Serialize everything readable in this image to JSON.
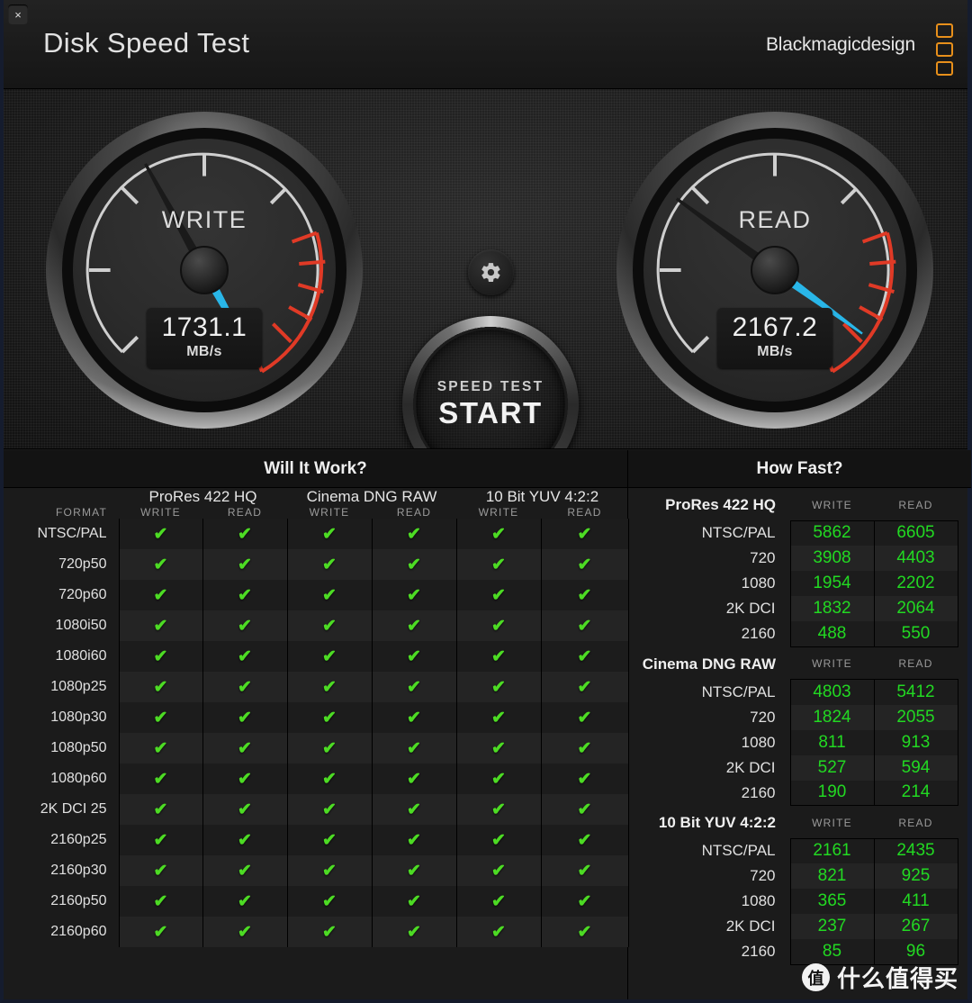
{
  "window": {
    "close_label": "×"
  },
  "header": {
    "title": "Disk Speed Test",
    "brand": "Blackmagicdesign"
  },
  "gauges": {
    "write": {
      "label": "WRITE",
      "value": "1731.1",
      "unit": "MB/s",
      "needle_angle_deg": -119
    },
    "read": {
      "label": "READ",
      "value": "2167.2",
      "unit": "MB/s",
      "needle_angle_deg": -144
    },
    "colors": {
      "needle": "#29b6e8",
      "redzone": "#e03a26",
      "scale": "#cfcfcf"
    }
  },
  "controls": {
    "gear_icon": "gear-icon",
    "start_sub": "SPEED TEST",
    "start_main": "START"
  },
  "will_it_work": {
    "title": "Will It Work?",
    "format_header": "FORMAT",
    "groups": [
      "ProRes 422 HQ",
      "Cinema DNG RAW",
      "10 Bit YUV 4:2:2"
    ],
    "sub_headers": [
      "WRITE",
      "READ"
    ],
    "check_glyph": "✔",
    "check_color": "#4ddb24",
    "rows": [
      {
        "format": "NTSC/PAL",
        "cells": [
          true,
          true,
          true,
          true,
          true,
          true
        ]
      },
      {
        "format": "720p50",
        "cells": [
          true,
          true,
          true,
          true,
          true,
          true
        ]
      },
      {
        "format": "720p60",
        "cells": [
          true,
          true,
          true,
          true,
          true,
          true
        ]
      },
      {
        "format": "1080i50",
        "cells": [
          true,
          true,
          true,
          true,
          true,
          true
        ]
      },
      {
        "format": "1080i60",
        "cells": [
          true,
          true,
          true,
          true,
          true,
          true
        ]
      },
      {
        "format": "1080p25",
        "cells": [
          true,
          true,
          true,
          true,
          true,
          true
        ]
      },
      {
        "format": "1080p30",
        "cells": [
          true,
          true,
          true,
          true,
          true,
          true
        ]
      },
      {
        "format": "1080p50",
        "cells": [
          true,
          true,
          true,
          true,
          true,
          true
        ]
      },
      {
        "format": "1080p60",
        "cells": [
          true,
          true,
          true,
          true,
          true,
          true
        ]
      },
      {
        "format": "2K DCI 25",
        "cells": [
          true,
          true,
          true,
          true,
          true,
          true
        ]
      },
      {
        "format": "2160p25",
        "cells": [
          true,
          true,
          true,
          true,
          true,
          true
        ]
      },
      {
        "format": "2160p30",
        "cells": [
          true,
          true,
          true,
          true,
          true,
          true
        ]
      },
      {
        "format": "2160p50",
        "cells": [
          true,
          true,
          true,
          true,
          true,
          true
        ]
      },
      {
        "format": "2160p60",
        "cells": [
          true,
          true,
          true,
          true,
          true,
          true
        ]
      }
    ]
  },
  "how_fast": {
    "title": "How Fast?",
    "col_write": "WRITE",
    "col_read": "READ",
    "value_color": "#22d922",
    "blocks": [
      {
        "name": "ProRes 422 HQ",
        "rows": [
          {
            "format": "NTSC/PAL",
            "write": "5862",
            "read": "6605"
          },
          {
            "format": "720",
            "write": "3908",
            "read": "4403"
          },
          {
            "format": "1080",
            "write": "1954",
            "read": "2202"
          },
          {
            "format": "2K DCI",
            "write": "1832",
            "read": "2064"
          },
          {
            "format": "2160",
            "write": "488",
            "read": "550"
          }
        ]
      },
      {
        "name": "Cinema DNG RAW",
        "rows": [
          {
            "format": "NTSC/PAL",
            "write": "4803",
            "read": "5412"
          },
          {
            "format": "720",
            "write": "1824",
            "read": "2055"
          },
          {
            "format": "1080",
            "write": "811",
            "read": "913"
          },
          {
            "format": "2K DCI",
            "write": "527",
            "read": "594"
          },
          {
            "format": "2160",
            "write": "190",
            "read": "214"
          }
        ]
      },
      {
        "name": "10 Bit YUV 4:2:2",
        "rows": [
          {
            "format": "NTSC/PAL",
            "write": "2161",
            "read": "2435"
          },
          {
            "format": "720",
            "write": "821",
            "read": "925"
          },
          {
            "format": "1080",
            "write": "365",
            "read": "411"
          },
          {
            "format": "2K DCI",
            "write": "237",
            "read": "267"
          },
          {
            "format": "2160",
            "write": "85",
            "read": "96"
          }
        ]
      }
    ]
  },
  "watermark": {
    "logo": "值",
    "text": "什么值得买"
  }
}
